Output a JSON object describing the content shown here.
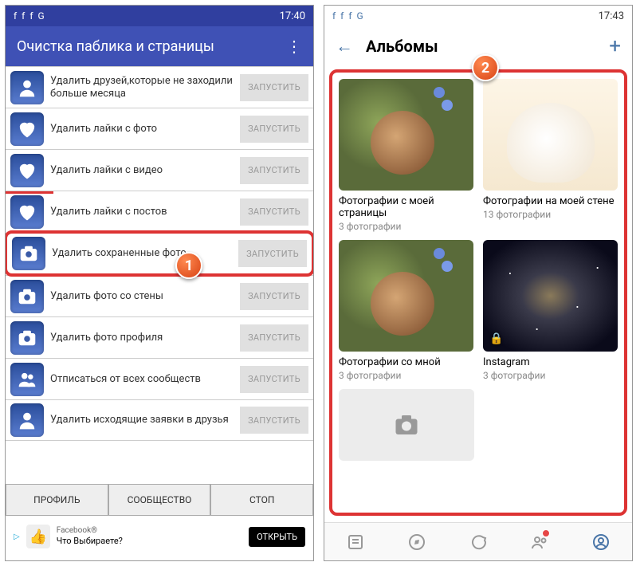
{
  "left": {
    "status": {
      "time": "17:40"
    },
    "appbar": {
      "title": "Очистка паблика и страницы"
    },
    "rows": [
      {
        "label": "Удалить друзей,которые не заходили больше месяца",
        "btn": "ЗАПУСТИТЬ",
        "icon": "person"
      },
      {
        "label": "Удалить лайки с фото",
        "btn": "ЗАПУСТИТЬ",
        "icon": "heart"
      },
      {
        "label": "Удалить лайки с видео",
        "btn": "ЗАПУСТИТЬ",
        "icon": "heart"
      },
      {
        "label": "Удалить лайки с постов",
        "btn": "ЗАПУСТИТЬ",
        "icon": "heart"
      },
      {
        "label": "Удалить сохраненные фото",
        "btn": "ЗАПУСТИТЬ",
        "icon": "camera",
        "highlighted": true
      },
      {
        "label": "Удалить фото со стены",
        "btn": "ЗАПУСТИТЬ",
        "icon": "camera"
      },
      {
        "label": "Удалить фото профиля",
        "btn": "ЗАПУСТИТЬ",
        "icon": "camera"
      },
      {
        "label": "Отписаться от всех сообществ",
        "btn": "ЗАПУСТИТЬ",
        "icon": "group"
      },
      {
        "label": "Удалить исходящие заявки в друзья",
        "btn": "ЗАПУСТИТЬ",
        "icon": "person"
      }
    ],
    "tabs": {
      "profile": "ПРОФИЛЬ",
      "community": "СООБЩЕСТВО",
      "stop": "СТОП"
    },
    "ad": {
      "brand": "Facebook®",
      "text": "Что Выбираете?",
      "btn": "ОТКРЫТЬ"
    }
  },
  "right": {
    "status": {
      "time": "17:43"
    },
    "header": {
      "title": "Альбомы"
    },
    "albums": [
      {
        "title": "Фотографии с моей страницы",
        "count": "3 фотографии",
        "thumb": "dog"
      },
      {
        "title": "Фотографии на моей стене",
        "count": "13 фотографии",
        "thumb": "whitedog"
      },
      {
        "title": "Фотографии со мной",
        "count": "3 фотографии",
        "thumb": "dog"
      },
      {
        "title": "Instagram",
        "count": "3 фотографии",
        "thumb": "galaxy",
        "locked": true
      }
    ]
  },
  "badges": {
    "b1": "1",
    "b2": "2"
  }
}
